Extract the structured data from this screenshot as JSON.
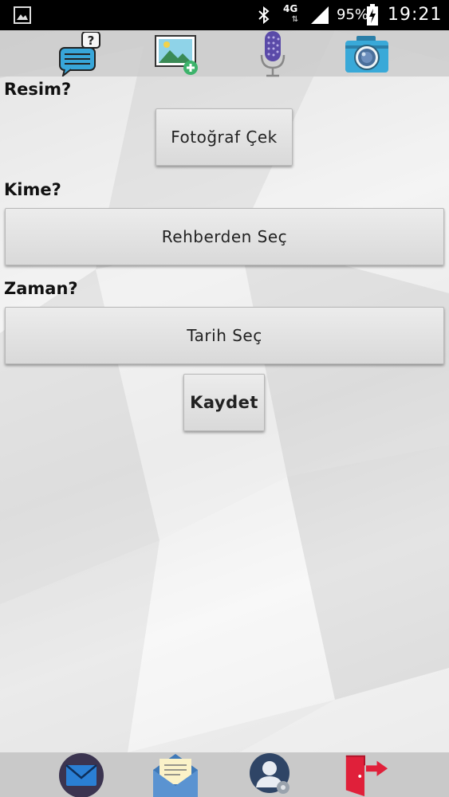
{
  "status_bar": {
    "network": "4G",
    "battery_percent": "95%",
    "clock": "19:21"
  },
  "toolbar": {
    "items": [
      {
        "icon": "chat-question-icon"
      },
      {
        "icon": "add-image-icon"
      },
      {
        "icon": "microphone-icon"
      },
      {
        "icon": "camera-icon"
      }
    ]
  },
  "form": {
    "picture_label": "Resim?",
    "take_photo_label": "Fotoğraf Çek",
    "recipient_label": "Kime?",
    "contacts_label": "Rehberden Seç",
    "time_label": "Zaman?",
    "date_label": "Tarih Seç",
    "save_label": "Kaydet"
  },
  "bottom_bar": {
    "items": [
      {
        "icon": "mail-icon"
      },
      {
        "icon": "open-envelope-icon"
      },
      {
        "icon": "contact-settings-icon"
      },
      {
        "icon": "exit-icon"
      }
    ]
  },
  "colors": {
    "mail_circle": "#3b3450",
    "mail_blue": "#2a7fd4",
    "exit_red": "#e0203a",
    "mic_purple": "#5a4aa8",
    "chat_blue": "#38a6d9",
    "camera_teal": "#39a9d8"
  }
}
